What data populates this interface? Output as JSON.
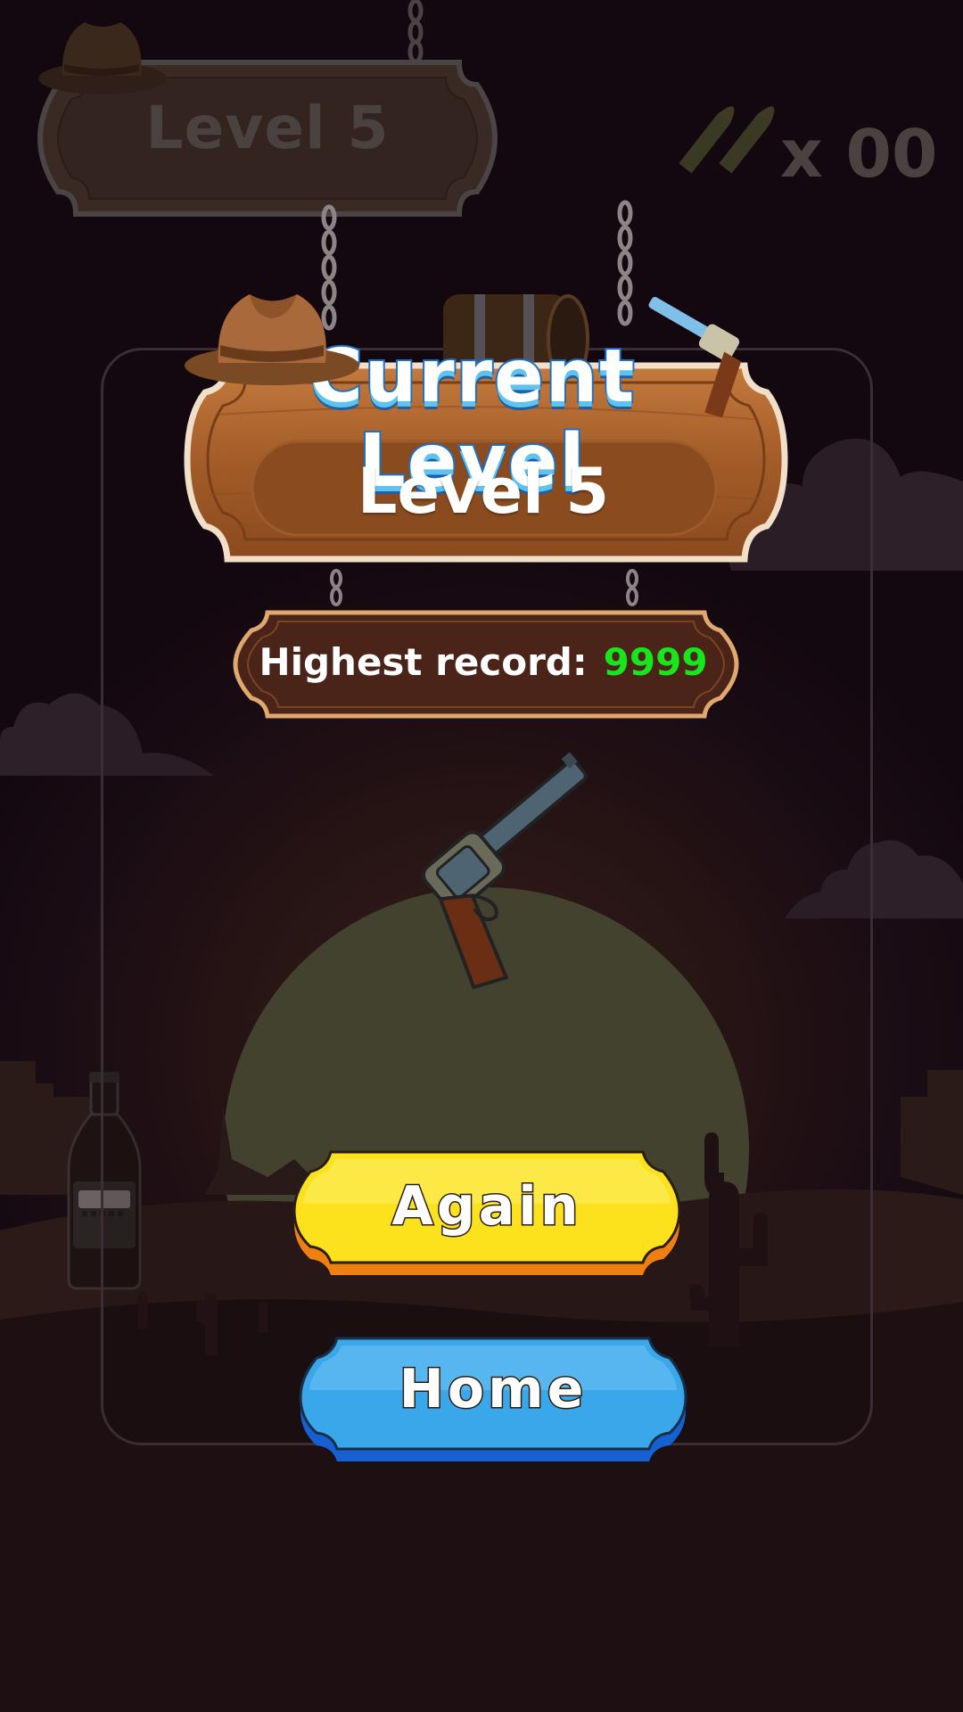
{
  "hud": {
    "level_label": "Level 5",
    "ammo_count": "x 00"
  },
  "dialog": {
    "title": "Current Level",
    "level_label": "Level 5",
    "record_label": "Highest record:",
    "record_value": "9999",
    "again_label": "Again",
    "home_label": "Home"
  },
  "colors": {
    "record_value": "#18e61d",
    "again_button": "#fbe21c",
    "home_button": "#3aa7ea",
    "wood": "#a8622d"
  },
  "icons": [
    "cowboy-hat-icon",
    "bullet-icon",
    "revolver-icon",
    "barrel-icon",
    "bottle-icon",
    "cactus-icon"
  ]
}
